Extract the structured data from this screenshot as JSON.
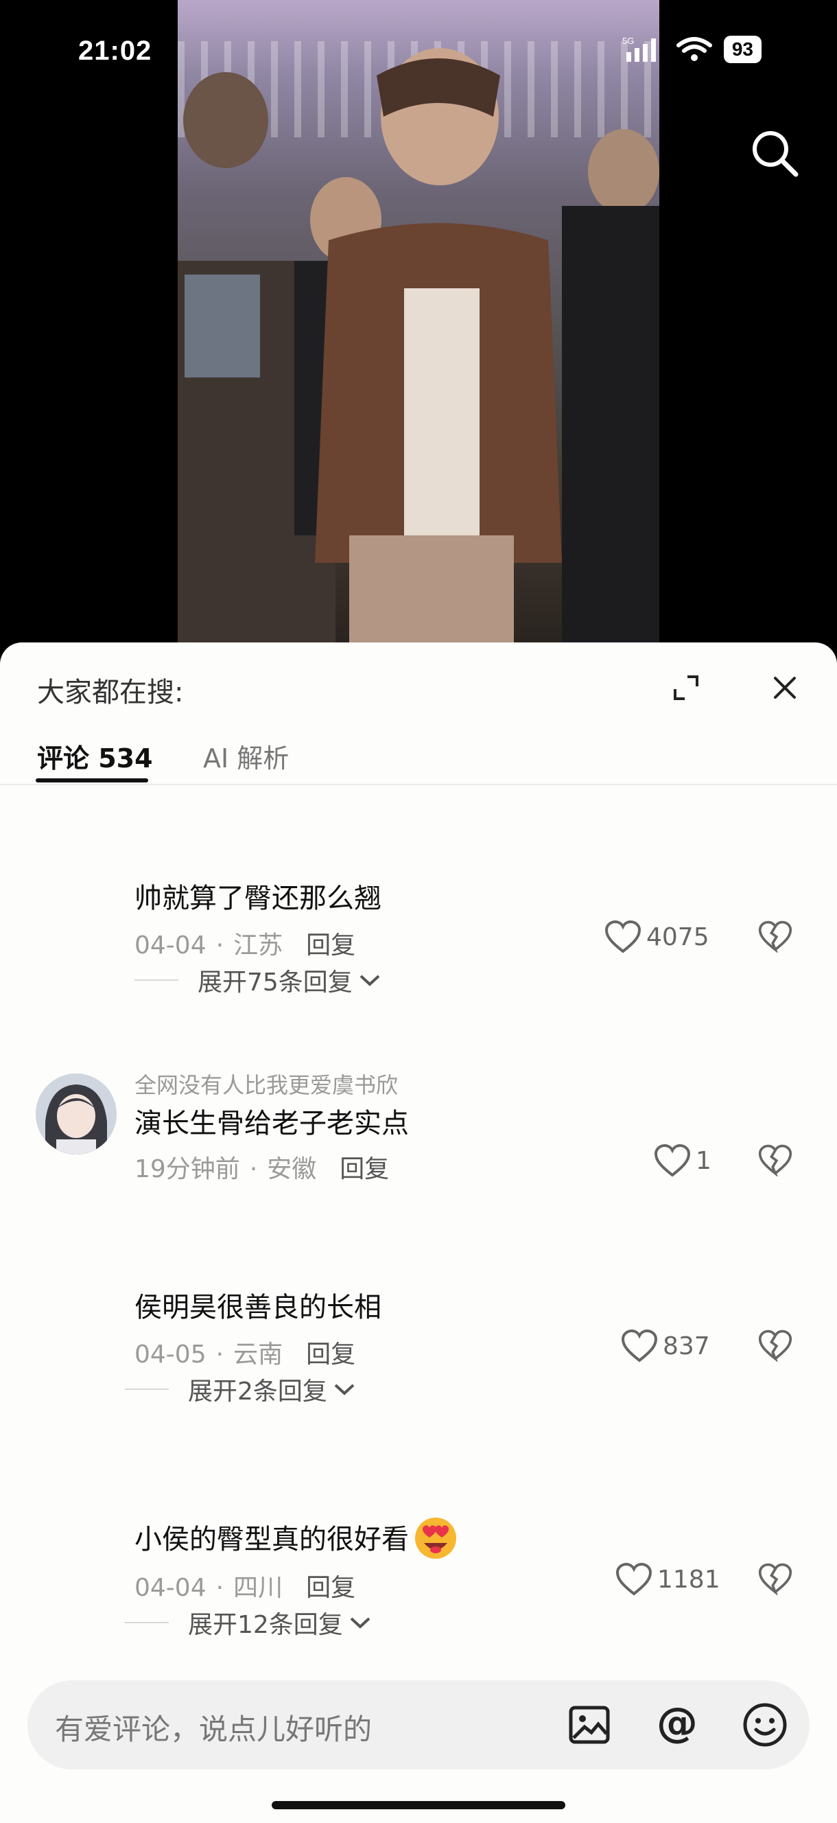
{
  "status": {
    "time": "21:02",
    "network": "5G",
    "battery": "93"
  },
  "sheet": {
    "trending_label": "大家都在搜:"
  },
  "tabs": [
    {
      "label": "评论 534"
    },
    {
      "label": "AI 解析"
    }
  ],
  "comments": [
    {
      "text": "帅就算了臀还那么翘",
      "date": "04-04",
      "location": "江苏",
      "reply": "回复",
      "likes": "4075",
      "expand": "展开75条回复"
    },
    {
      "username": "全网没有人比我更爱虞书欣",
      "text": "演长生骨给老子老实点",
      "date": "19分钟前",
      "location": "安徽",
      "reply": "回复",
      "likes": "1"
    },
    {
      "text": "侯明昊很善良的长相",
      "date": "04-05",
      "location": "云南",
      "reply": "回复",
      "likes": "837",
      "expand": "展开2条回复"
    },
    {
      "text": "小侯的臀型真的很好看",
      "date": "04-04",
      "location": "四川",
      "reply": "回复",
      "likes": "1181",
      "expand": "展开12条回复"
    }
  ],
  "input": {
    "placeholder": "有爱评论，说点儿好听的"
  }
}
